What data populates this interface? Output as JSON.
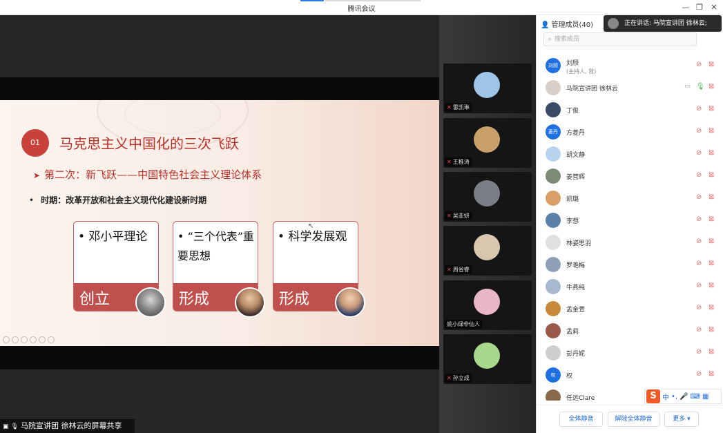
{
  "window": {
    "title": "腾讯会议",
    "controls": {
      "minimize": "—",
      "maximize": "❐",
      "close": "✕"
    }
  },
  "slide": {
    "badge": "01",
    "title": "马克思主义中国化的三次飞跃",
    "subtitle": "第二次：新飞跃——中国特色社会主义理论体系",
    "period": "时期：改革开放和社会主义现代化建设新时期",
    "cards": [
      {
        "text": "• 邓小平理论",
        "footer": "创立"
      },
      {
        "text": "•  “三个代表”重要思想",
        "footer": "形成"
      },
      {
        "text": "• 科学发展观",
        "footer": "形成"
      }
    ]
  },
  "share_label": "马院宣讲团 徐林云的屏幕共享",
  "gallery": [
    {
      "name": "雷凯琳",
      "color": "#9ec5e8"
    },
    {
      "name": "王稚涛",
      "color": "#c9a06a"
    },
    {
      "name": "吴亚妍",
      "color": "#7a7f86"
    },
    {
      "name": "周省睿",
      "color": "#d9c6ae"
    },
    {
      "name": "姚小绿非仙人",
      "color": "#e9b7c8"
    },
    {
      "name": "孙立成",
      "color": "#a8d88b"
    }
  ],
  "panel": {
    "title": "管理成员(40)",
    "search_placeholder": "搜索成员",
    "speaking": "正在讲话: 马院宣讲团 徐林云;",
    "members": [
      {
        "name": "刘颀",
        "sub": "(主持人, 我)",
        "avatar_text": "刘颀",
        "color": "#1e6fe0",
        "mic_on": false
      },
      {
        "name": "马院宣讲团 徐林云",
        "sub": "",
        "avatar_text": "",
        "color": "#d8cfc6",
        "mic_on": true
      },
      {
        "name": "丁俊",
        "sub": "",
        "avatar_text": "",
        "color": "#3b4a66",
        "mic_on": false
      },
      {
        "name": "方菱丹",
        "sub": "",
        "avatar_text": "菱丹",
        "color": "#1e6fe0",
        "mic_on": false
      },
      {
        "name": "胡文静",
        "sub": "",
        "avatar_text": "",
        "color": "#b9d4f0",
        "mic_on": false
      },
      {
        "name": "姜营辉",
        "sub": "",
        "avatar_text": "",
        "color": "#7c8a76",
        "mic_on": false
      },
      {
        "name": "凯璐",
        "sub": "",
        "avatar_text": "",
        "color": "#d8a066",
        "mic_on": false
      },
      {
        "name": "李想",
        "sub": "",
        "avatar_text": "",
        "color": "#5a7fa8",
        "mic_on": false
      },
      {
        "name": "林姿思羽",
        "sub": "",
        "avatar_text": "",
        "color": "#e0e0e0",
        "mic_on": false
      },
      {
        "name": "罗艳梅",
        "sub": "",
        "avatar_text": "",
        "color": "#8e9fb8",
        "mic_on": false
      },
      {
        "name": "牛燕纯",
        "sub": "",
        "avatar_text": "",
        "color": "#a8b8d0",
        "mic_on": false
      },
      {
        "name": "孟金萱",
        "sub": "",
        "avatar_text": "",
        "color": "#c88a3a",
        "mic_on": false
      },
      {
        "name": "孟莉",
        "sub": "",
        "avatar_text": "",
        "color": "#9a5a4a",
        "mic_on": false
      },
      {
        "name": "彭丹妮",
        "sub": "",
        "avatar_text": "",
        "color": "#cfcfcf",
        "mic_on": false
      },
      {
        "name": "权",
        "sub": "",
        "avatar_text": "权",
        "color": "#1e6fe0",
        "mic_on": false
      },
      {
        "name": "任远Clare",
        "sub": "",
        "avatar_text": "",
        "color": "#8a6a4a",
        "mic_on": false
      }
    ],
    "buttons": {
      "mute_all": "全体静音",
      "unmute_all": "解除全体静音",
      "more": "更多 ▾"
    }
  },
  "ime": {
    "logo": "S",
    "lang": "中"
  }
}
